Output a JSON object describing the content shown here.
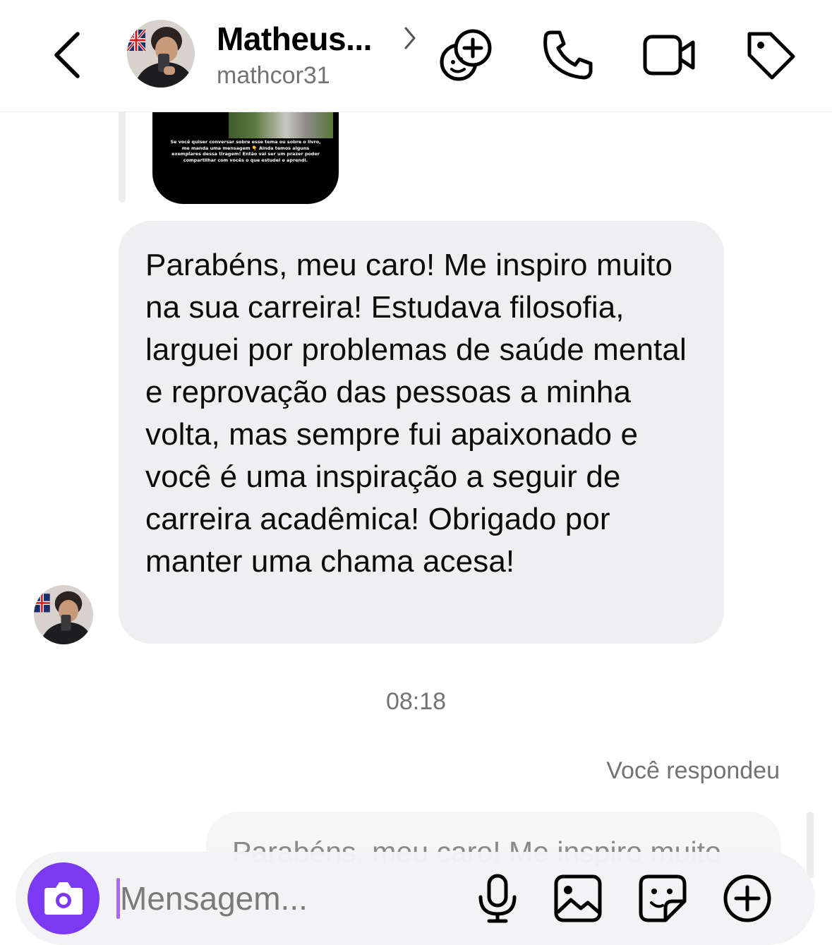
{
  "header": {
    "back_icon": "chevron-left-icon",
    "name": "Matheus...",
    "username": "mathcor31",
    "icons": [
      "sticker-add-icon",
      "phone-icon",
      "video-camera-icon",
      "tag-icon"
    ]
  },
  "story": {
    "caption": "Se você quiser conversar sobre esse tema ou sobre o livro, me manda uma mensagem 👇 Ainda temos alguns exemplares dessa tiragem! Então vai ser um prazer poder compartilhar com vocês o que estudei e aprendi."
  },
  "message": {
    "text": "Parabéns, meu caro! Me inspiro muito na sua carreira! Estudava filosofia, larguei por problemas de saúde mental e reprovação das pessoas a minha volta, mas sempre fui apaixonado e você é uma inspiração a seguir de carreira acadêmica! Obrigado por manter uma chama acesa!"
  },
  "timestamp": "08:18",
  "reply": {
    "label": "Você respondeu",
    "quoted": "Parabéns, meu caro! Me inspiro muito"
  },
  "composer": {
    "placeholder": "Mensagem...",
    "icons": [
      "camera-icon",
      "microphone-icon",
      "image-icon",
      "sticker-icon",
      "plus-circle-icon"
    ]
  },
  "colors": {
    "accent": "#7b3af2",
    "bubble": "#efeff1",
    "muted_text": "#737373"
  }
}
